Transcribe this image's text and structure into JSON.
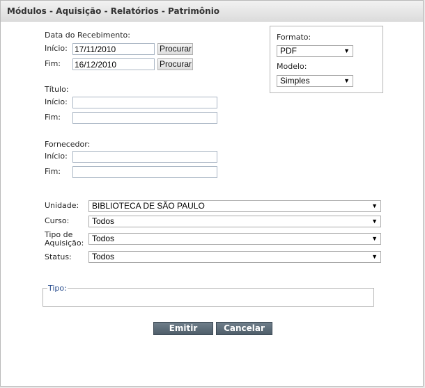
{
  "window": {
    "title": "Módulos - Aquisição - Relatórios - Patrimônio"
  },
  "recebimento": {
    "section_label": "Data do Recebimento:",
    "inicio_label": "Início:",
    "inicio_value": "17/11/2010",
    "fim_label": "Fim:",
    "fim_value": "16/12/2010",
    "procurar_label": "Procurar"
  },
  "titulo": {
    "section_label": "Título:",
    "inicio_label": "Início:",
    "inicio_value": "",
    "fim_label": "Fim:",
    "fim_value": ""
  },
  "fornecedor": {
    "section_label": "Fornecedor:",
    "inicio_label": "Início:",
    "inicio_value": "",
    "fim_label": "Fim:",
    "fim_value": ""
  },
  "config": {
    "formato_label": "Formato:",
    "formato_value": "PDF",
    "modelo_label": "Modelo:",
    "modelo_value": "Simples"
  },
  "filters": {
    "unidade_label": "Unidade:",
    "unidade_value": "BIBLIOTECA DE SÃO PAULO",
    "curso_label": "Curso:",
    "curso_value": "Todos",
    "tipo_aquisicao_label_line1": "Tipo de",
    "tipo_aquisicao_label_line2": "Aquisição:",
    "tipo_aquisicao_value": "Todos",
    "status_label": "Status:",
    "status_value": "Todos"
  },
  "tipo": {
    "legend": "Tipo:"
  },
  "actions": {
    "emitir_label": "Emitir",
    "cancelar_label": "Cancelar"
  },
  "icons": {
    "dropdown": "chevron-down-icon"
  }
}
